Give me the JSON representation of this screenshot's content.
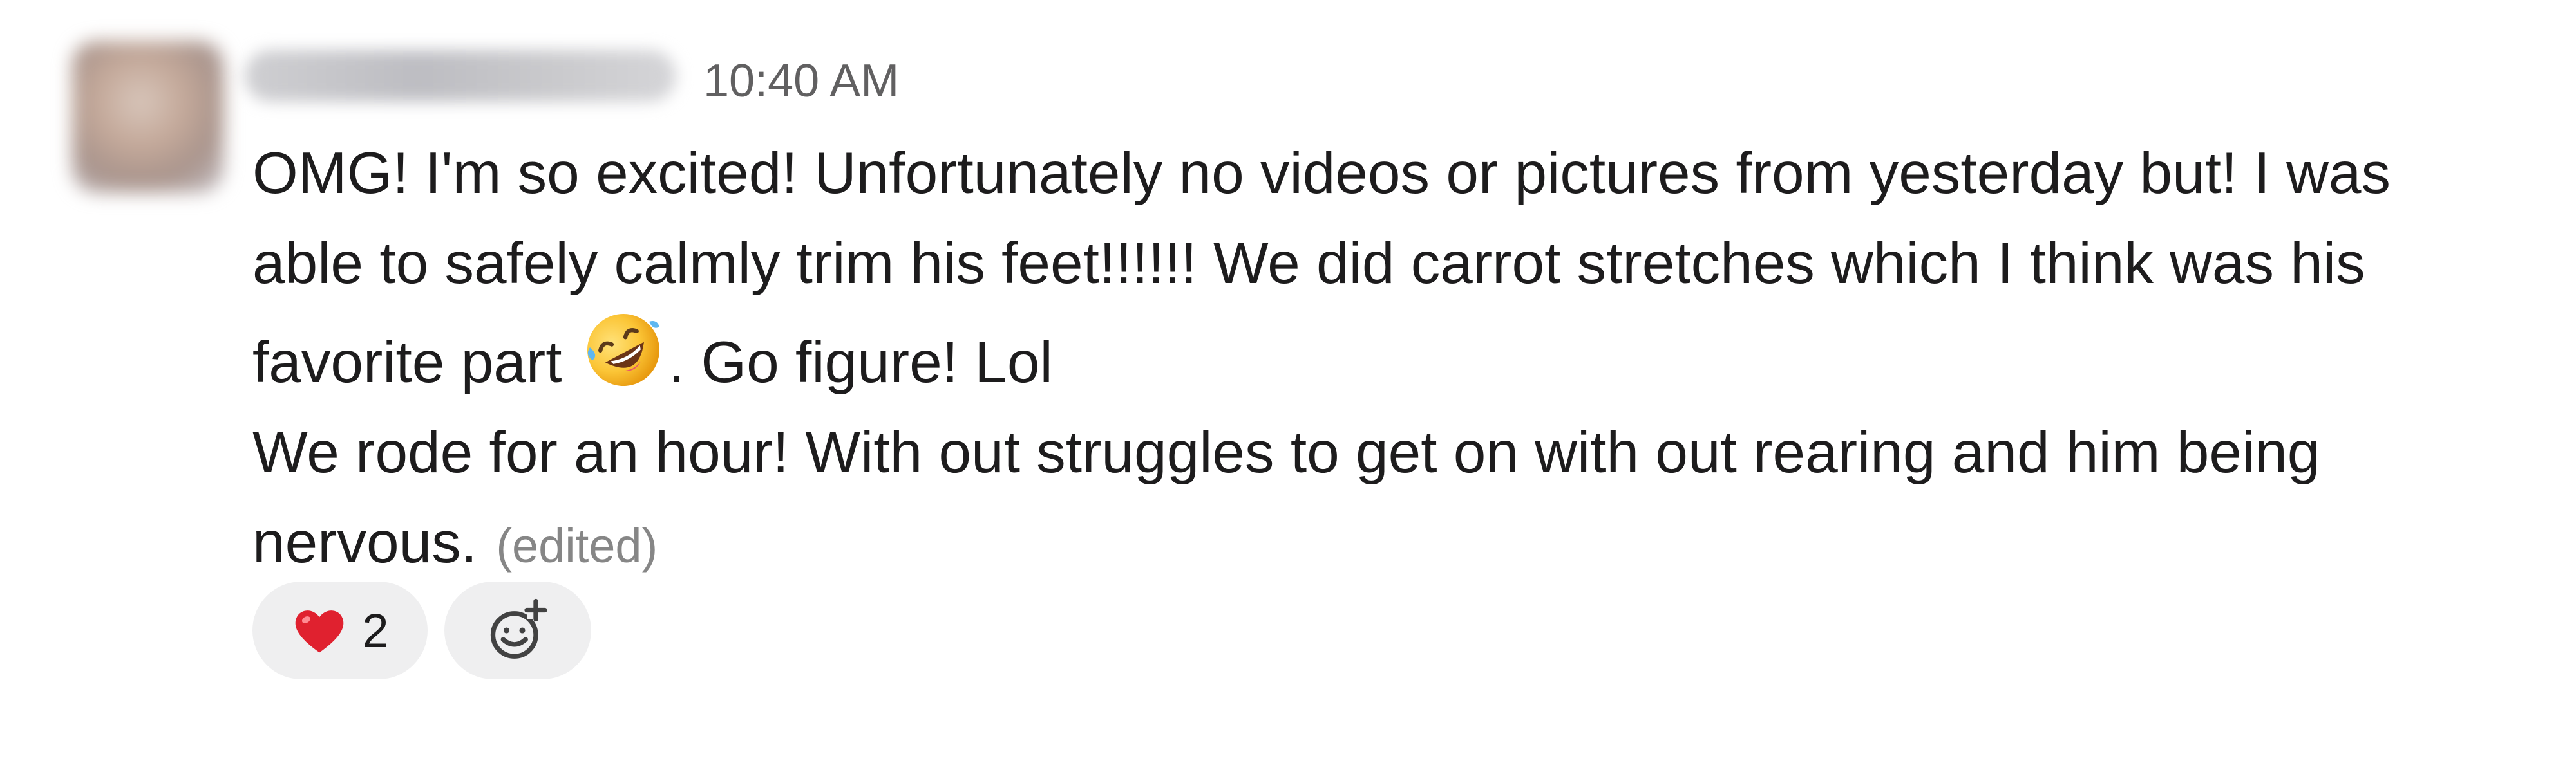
{
  "message": {
    "sender_name": "Dez and John B",
    "timestamp": "10:40 AM",
    "body_lines": {
      "line1": "OMG! I'm so excited! Unfortunately no videos or pictures from yesterday but! I was",
      "line2": "able to safely calmly trim his feet!!!!!! We did carrot stretches which I think was his",
      "line3_before_emoji": "favorite part",
      "line3_after_emoji": ".  Go figure! Lol",
      "line4": "We rode for an hour! With out struggles to get on with out rearing and him being",
      "line5": "nervous."
    },
    "inline_emoji": "rolling-on-the-floor-laughing-icon",
    "edited_label": "(edited)"
  },
  "reactions": [
    {
      "emoji": "heart-icon",
      "count": "2"
    },
    {
      "emoji": "add-reaction-icon"
    }
  ],
  "colors": {
    "text": "#1d1c1d",
    "muted": "#616061",
    "edited": "#868686",
    "pill_bg": "#efeff0",
    "heart": "#e0212f"
  }
}
